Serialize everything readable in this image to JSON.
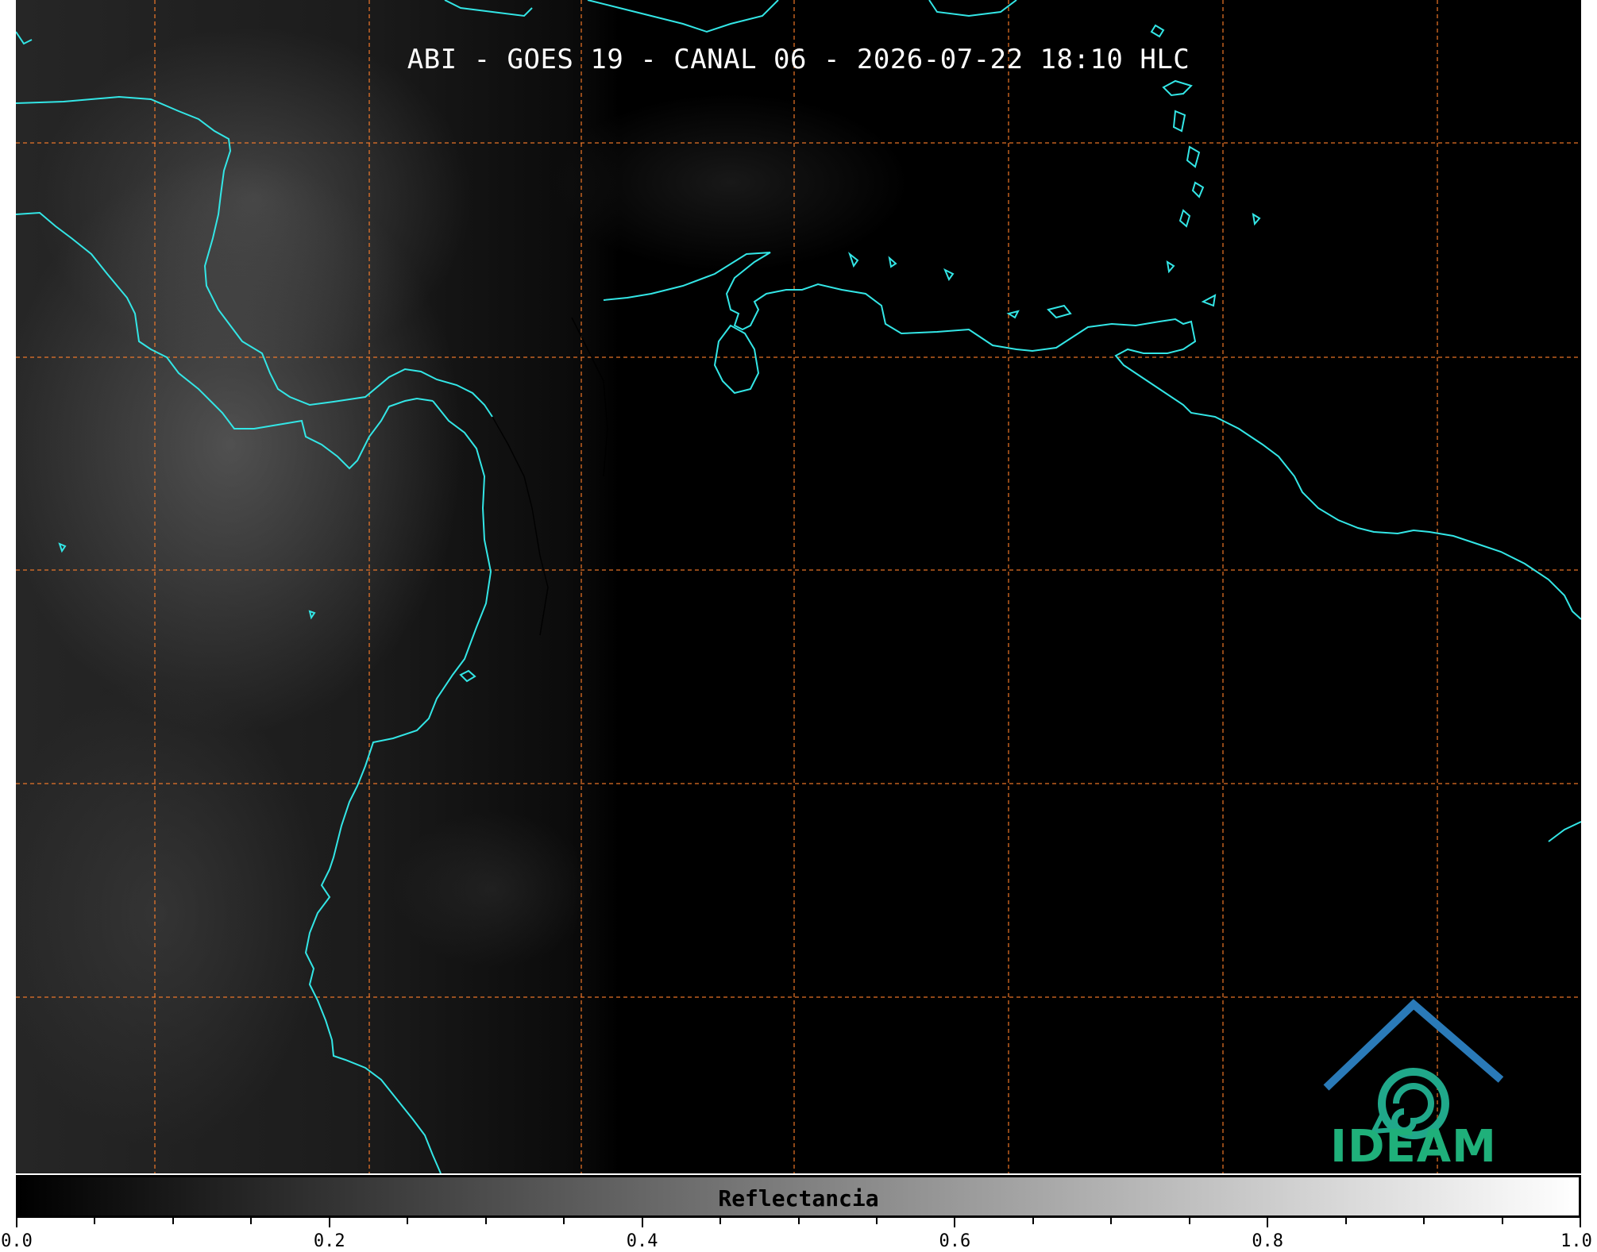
{
  "title": "ABI - GOES 19 - CANAL 06 - 2026-07-22 18:10 HLC",
  "colorbar": {
    "label": "Reflectancia",
    "range": [
      0.0,
      1.0
    ],
    "colormap": "gray",
    "major_tick_labels": [
      "0.0",
      "0.2",
      "0.4",
      "0.6",
      "0.8",
      "1.0"
    ],
    "minor_tick_count_between_major": 3
  },
  "map": {
    "coastline_color": "#33e6e6",
    "gridline_color": "#ff7f2a",
    "gridline_style": "dashed",
    "border_color": "#000000"
  },
  "logo": {
    "text": "IDEAM",
    "text_color": "#1fb07a",
    "roof_color": "#2a6fb0",
    "swirl_color": "#1fa08a"
  }
}
